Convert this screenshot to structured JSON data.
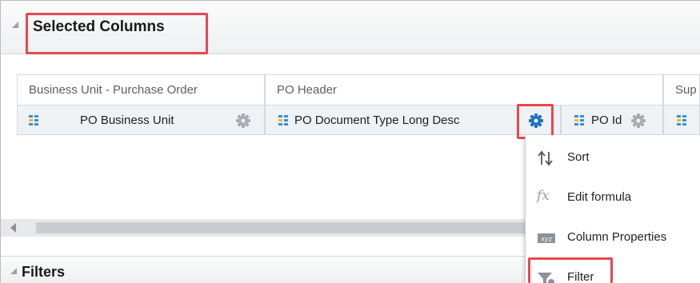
{
  "selected_columns": {
    "title": "Selected Columns"
  },
  "groups": [
    {
      "label": "Business Unit - Purchase Order"
    },
    {
      "label": "PO Header"
    },
    {
      "label": "Sup"
    }
  ],
  "columns": [
    {
      "label": "PO Business Unit"
    },
    {
      "label": "PO Document Type Long Desc"
    },
    {
      "label": "PO Id"
    }
  ],
  "menu": {
    "items": [
      {
        "label": "Sort",
        "icon": "sort-icon"
      },
      {
        "label": "Edit formula",
        "icon": "formula-icon"
      },
      {
        "label": "Column Properties",
        "icon": "column-properties-icon"
      },
      {
        "label": "Filter",
        "icon": "filter-icon"
      }
    ]
  },
  "filters": {
    "title": "Filters"
  },
  "colors": {
    "highlight": "#e8474f",
    "gear_active": "#1f6fc5",
    "gear_inactive": "#a7acb1",
    "column_bg": "#eef2f5"
  }
}
